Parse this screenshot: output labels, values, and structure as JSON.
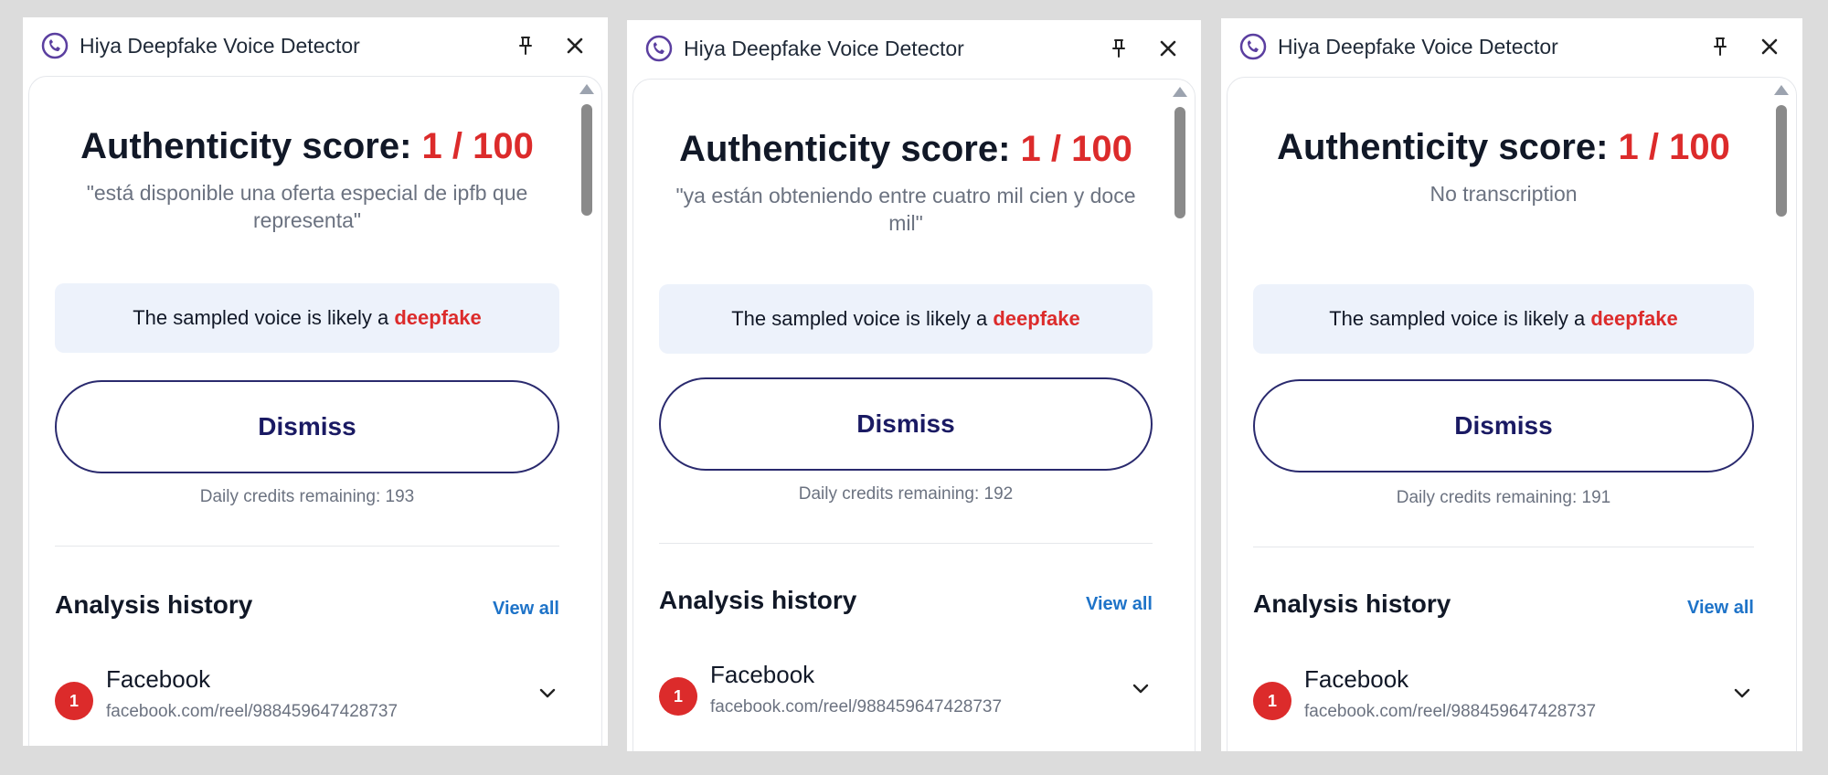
{
  "panels": [
    {
      "app_title": "Hiya Deepfake Voice Detector",
      "score_label": "Authenticity score: ",
      "score_value": "1 / 100",
      "transcript": "\"está disponible una oferta especial de ipfb que representa\"",
      "verdict_prefix": "The sampled voice is likely a ",
      "verdict_word": "deepfake",
      "dismiss_label": "Dismiss",
      "credits_text": "Daily credits remaining: 193",
      "history_title": "Analysis history",
      "view_all_label": "View all",
      "history_items": [
        {
          "score": "1",
          "title": "Facebook",
          "url": "facebook.com/reel/988459647428737"
        }
      ]
    },
    {
      "app_title": "Hiya Deepfake Voice Detector",
      "score_label": "Authenticity score: ",
      "score_value": "1 / 100",
      "transcript": "\"ya están obteniendo entre cuatro mil cien y doce mil\"",
      "verdict_prefix": "The sampled voice is likely a ",
      "verdict_word": "deepfake",
      "dismiss_label": "Dismiss",
      "credits_text": "Daily credits remaining: 192",
      "history_title": "Analysis history",
      "view_all_label": "View all",
      "history_items": [
        {
          "score": "1",
          "title": "Facebook",
          "url": "facebook.com/reel/988459647428737"
        }
      ]
    },
    {
      "app_title": "Hiya Deepfake Voice Detector",
      "score_label": "Authenticity score: ",
      "score_value": "1 / 100",
      "transcript": "No transcription",
      "verdict_prefix": "The sampled voice is likely a ",
      "verdict_word": "deepfake",
      "dismiss_label": "Dismiss",
      "credits_text": "Daily credits remaining: 191",
      "history_title": "Analysis history",
      "view_all_label": "View all",
      "history_items": [
        {
          "score": "1",
          "title": "Facebook",
          "url": "facebook.com/reel/988459647428737"
        }
      ]
    }
  ],
  "colors": {
    "accent_red": "#dc2b2b",
    "dismiss_border": "#2a2a6e",
    "link_blue": "#1e73c8",
    "logo_purple": "#5b3fa0",
    "verdict_bg": "#edf2fb"
  },
  "icons": {
    "logo": "hiya-logo-icon",
    "pin": "pin-icon",
    "close": "close-icon",
    "expand": "chevron-down-icon"
  }
}
